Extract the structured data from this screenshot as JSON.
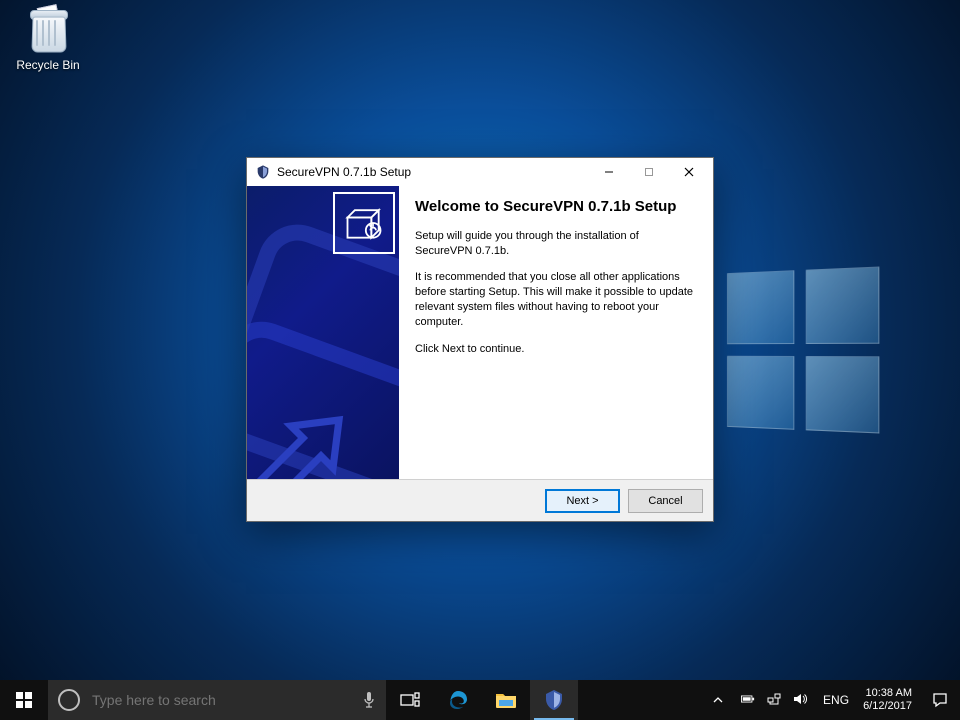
{
  "desktop": {
    "recycle_bin_label": "Recycle Bin"
  },
  "installer": {
    "window_title": "SecureVPN 0.7.1b Setup",
    "heading": "Welcome to SecureVPN 0.7.1b Setup",
    "para1": "Setup will guide you through the installation of SecureVPN 0.7.1b.",
    "para2": "It is recommended that you close all other applications before starting Setup. This will make it possible to update relevant system files without having to reboot your computer.",
    "para3": "Click Next to continue.",
    "next_label": "Next >",
    "cancel_label": "Cancel"
  },
  "taskbar": {
    "search_placeholder": "Type here to search",
    "language": "ENG",
    "time": "10:38 AM",
    "date": "6/12/2017"
  }
}
